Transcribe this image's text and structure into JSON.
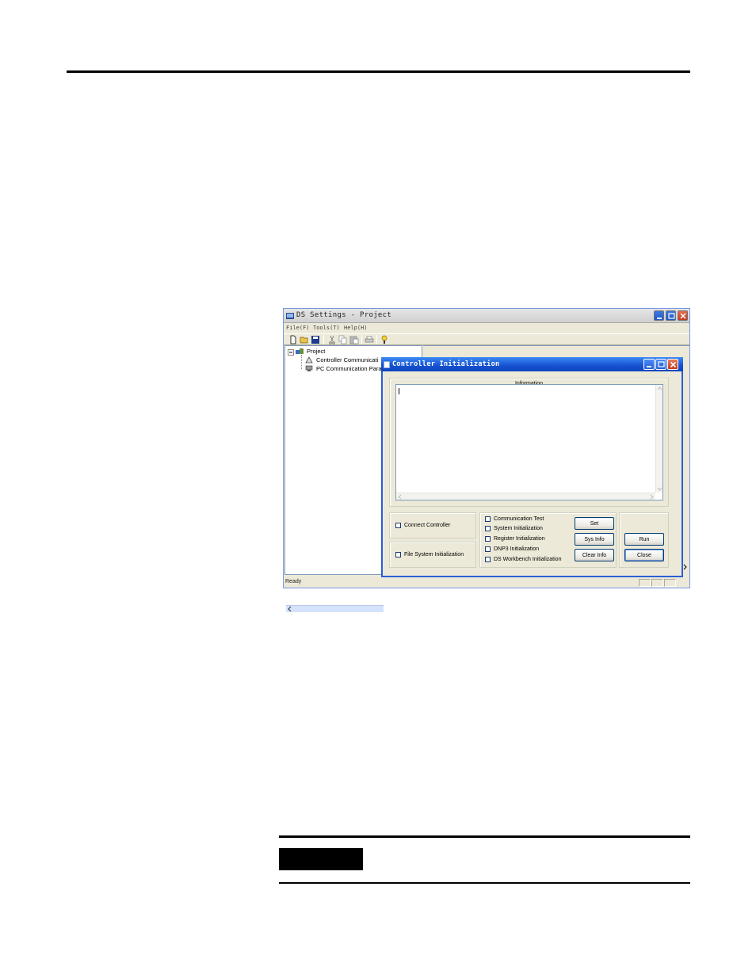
{
  "app": {
    "title": "DS Settings - Project",
    "menu": [
      "File(F)",
      "Tools(T)",
      "Help(H)"
    ],
    "toolbar_icons": [
      "new-file-icon",
      "open-folder-icon",
      "save-icon",
      "cut-icon",
      "copy-icon",
      "paste-icon",
      "print-icon",
      "help-icon"
    ],
    "tree": {
      "root": "Project",
      "children": [
        "Controller Communicati",
        "PC Communication Para"
      ]
    },
    "status": "Ready"
  },
  "dialog": {
    "title": "Controller Initialization",
    "info_caption": "Information",
    "info_text": "",
    "connect_controller": "Connect Controller",
    "file_system_init": "File System Initialization",
    "options": [
      "Communication Test",
      "System Initialization",
      "Register Initialization",
      "DNP3 Initialization",
      "DS Workbench Initialization"
    ],
    "buttons": {
      "set": "Set",
      "sys_info": "Sys Info",
      "clear_info": "Clear Info",
      "run": "Run",
      "close": "Close"
    }
  }
}
